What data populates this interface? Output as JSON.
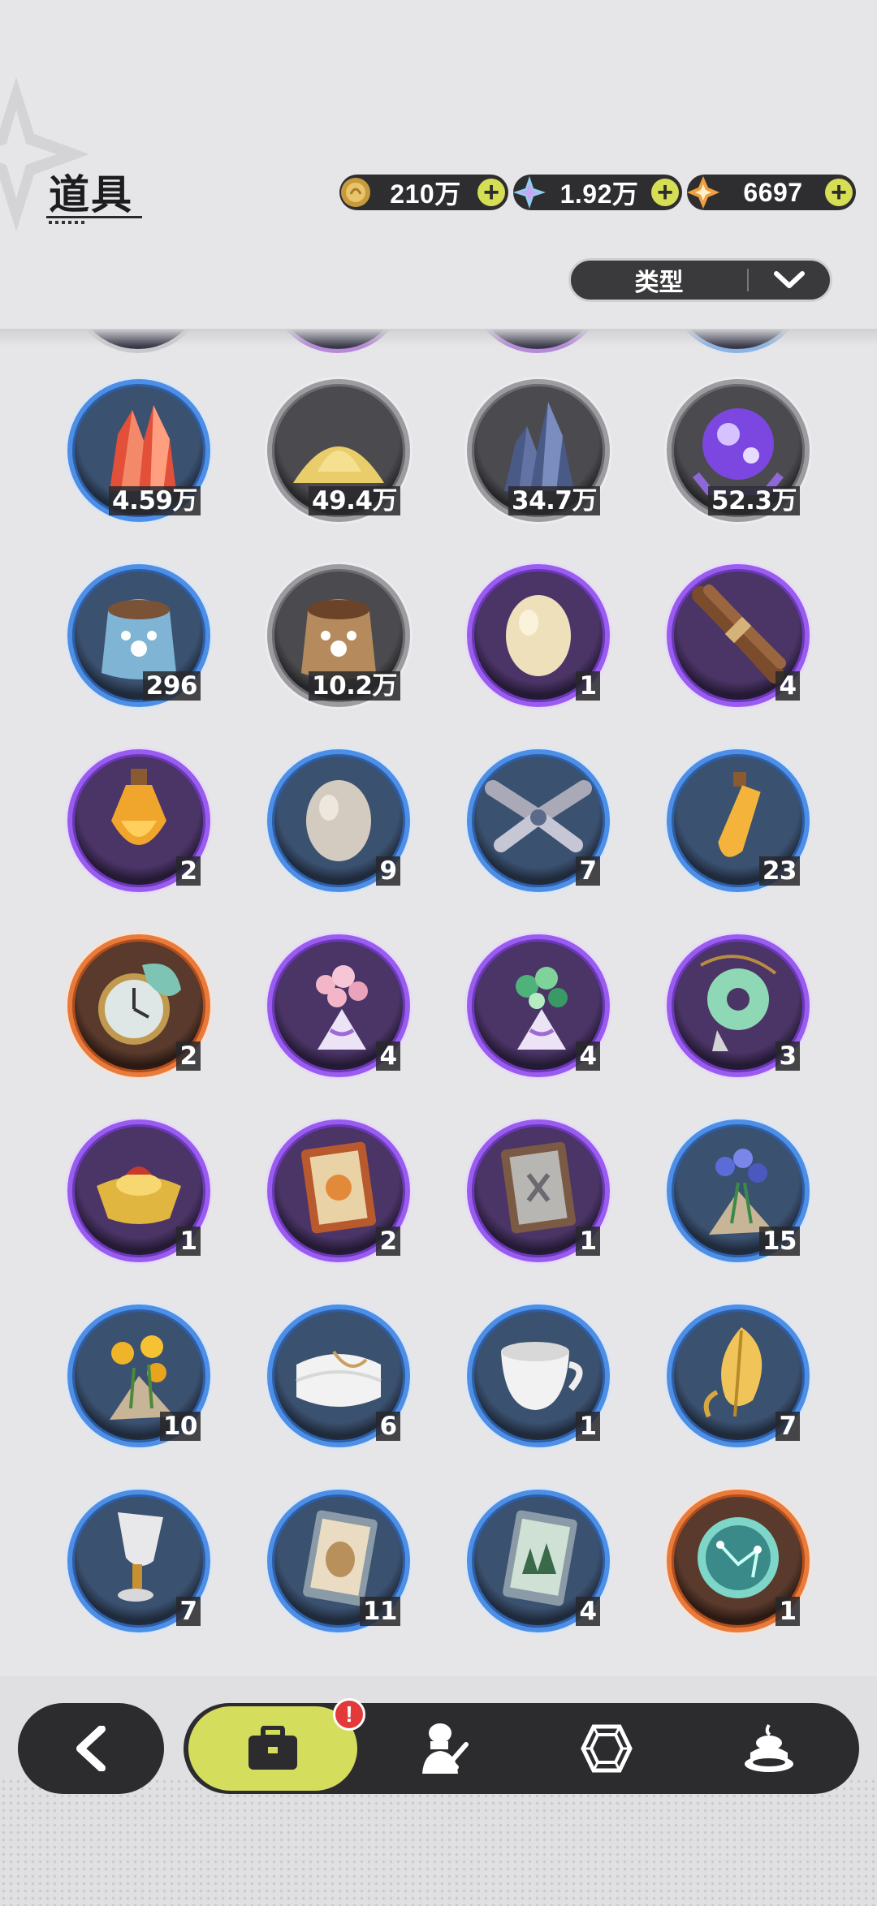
{
  "header": {
    "title": "道具",
    "currencies": [
      {
        "icon": "gold-coin-icon",
        "value": "210万",
        "plus": "+"
      },
      {
        "icon": "crystal-gem-icon",
        "value": "1.92万",
        "plus": "+"
      },
      {
        "icon": "orange-star-gem-icon",
        "value": "6697",
        "plus": "+"
      }
    ]
  },
  "filter": {
    "label": "类型"
  },
  "items": [
    {
      "name": "red-crystal",
      "rarity": "blue",
      "count": "4.59万"
    },
    {
      "name": "gold-sand",
      "rarity": "gray",
      "count": "49.4万"
    },
    {
      "name": "dark-crystal",
      "rarity": "gray",
      "count": "34.7万"
    },
    {
      "name": "purple-orb",
      "rarity": "gray",
      "count": "52.3万"
    },
    {
      "name": "blue-pet-food-bag",
      "rarity": "blue",
      "count": "296"
    },
    {
      "name": "brown-pet-food-bag",
      "rarity": "gray",
      "count": "10.2万"
    },
    {
      "name": "beige-egg",
      "rarity": "purple",
      "count": "1"
    },
    {
      "name": "brown-herb-bundle",
      "rarity": "purple",
      "count": "4"
    },
    {
      "name": "amber-potion-bottle",
      "rarity": "purple",
      "count": "2"
    },
    {
      "name": "white-egg",
      "rarity": "blue",
      "count": "9"
    },
    {
      "name": "gray-herb-bundle",
      "rarity": "blue",
      "count": "7"
    },
    {
      "name": "amber-vial",
      "rarity": "blue",
      "count": "23"
    },
    {
      "name": "pocket-watch",
      "rarity": "orange",
      "count": "2"
    },
    {
      "name": "pink-flower-bouquet",
      "rarity": "purple",
      "count": "4"
    },
    {
      "name": "green-flower-bouquet",
      "rarity": "purple",
      "count": "4"
    },
    {
      "name": "jade-pendant",
      "rarity": "purple",
      "count": "3"
    },
    {
      "name": "gold-ingot",
      "rarity": "purple",
      "count": "1"
    },
    {
      "name": "orange-book",
      "rarity": "purple",
      "count": "2"
    },
    {
      "name": "gray-book",
      "rarity": "purple",
      "count": "1"
    },
    {
      "name": "blue-flower-bouquet",
      "rarity": "blue",
      "count": "15"
    },
    {
      "name": "sunflower-bouquet",
      "rarity": "blue",
      "count": "10"
    },
    {
      "name": "white-towel",
      "rarity": "blue",
      "count": "6"
    },
    {
      "name": "tea-cup",
      "rarity": "blue",
      "count": "1"
    },
    {
      "name": "golden-leaf",
      "rarity": "blue",
      "count": "7"
    },
    {
      "name": "goblet",
      "rarity": "blue",
      "count": "7"
    },
    {
      "name": "sack-card",
      "rarity": "blue",
      "count": "11"
    },
    {
      "name": "forest-card",
      "rarity": "blue",
      "count": "4"
    },
    {
      "name": "constellation-orb",
      "rarity": "orange",
      "count": "1"
    }
  ],
  "nav": {
    "back": "back-arrow-icon",
    "tabs": [
      {
        "icon": "briefcase-icon",
        "active": true,
        "badge": "!"
      },
      {
        "icon": "weapon-bust-icon",
        "active": false
      },
      {
        "icon": "hexagon-gem-icon",
        "active": false
      },
      {
        "icon": "cake-icon",
        "active": false
      }
    ]
  },
  "colors": {
    "accent": "#d4dd5c",
    "blue_ring": "#4d8fe6",
    "purple_ring": "#9a5cf0",
    "gray_ring": "#9b9ba0",
    "orange_ring": "#ea7a3a"
  }
}
